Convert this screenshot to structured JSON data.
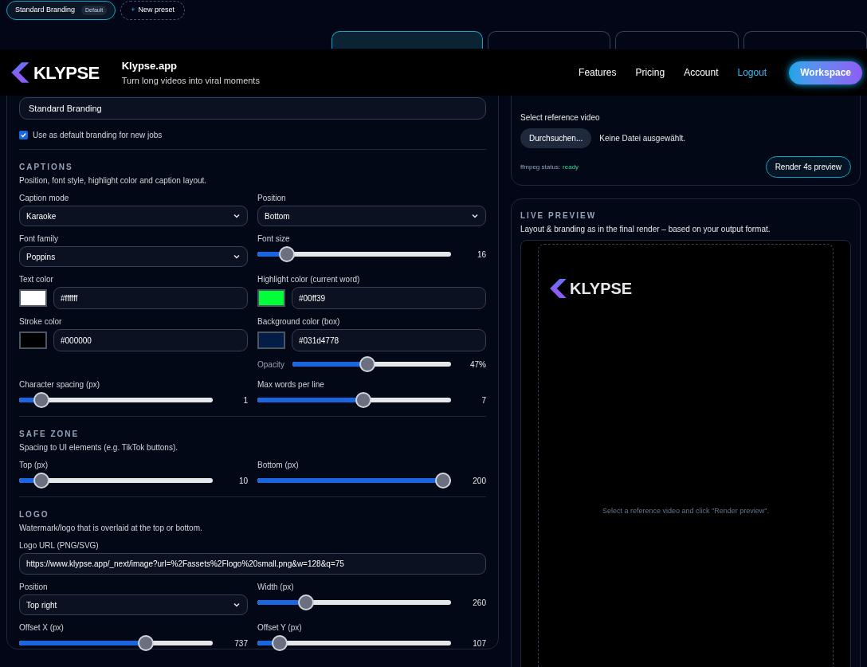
{
  "presets": [
    {
      "label": "Standard Branding",
      "badge": "Default",
      "selected": true
    }
  ],
  "new_preset": {
    "icon": "+",
    "label": "New preset"
  },
  "format_chips": [
    {
      "selected": true
    },
    {
      "selected": false
    },
    {
      "selected": false
    },
    {
      "selected": false
    }
  ],
  "header": {
    "logo_text": "KLYPSE",
    "title": "Klypse.app",
    "subtitle": "Turn long videos into viral moments",
    "nav": [
      {
        "label": "Features",
        "kind": "link"
      },
      {
        "label": "Pricing",
        "kind": "link"
      },
      {
        "label": "Account",
        "kind": "link"
      },
      {
        "label": "Logout",
        "kind": "accent"
      },
      {
        "label": "Workspace",
        "kind": "button"
      }
    ]
  },
  "preset_name": {
    "value": "Standard Branding"
  },
  "default_checkbox": {
    "label": "Use as default branding for new jobs",
    "checked": true
  },
  "sections": [
    {
      "heading": "CAPTIONS",
      "description": "Position, font style, highlight color and caption layout.",
      "fields": [
        {
          "kind": "select",
          "label": "Caption mode",
          "value": "Karaoke"
        },
        {
          "kind": "select",
          "label": "Position",
          "value": "Bottom"
        },
        {
          "kind": "select",
          "label": "Font family",
          "value": "Poppins"
        },
        {
          "kind": "slider",
          "label": "Font size",
          "level": 0.12,
          "reading": "16"
        },
        {
          "kind": "color",
          "label": "Text color",
          "value": "#ffffff",
          "color": "#ffffff"
        },
        {
          "kind": "color",
          "label": "Highlight color (current word)",
          "value": "#00ff39",
          "color": "#00ff39"
        },
        {
          "kind": "color",
          "label": "Stroke color",
          "value": "#000000",
          "color": "#000000"
        },
        {
          "kind": "color",
          "label": "Background color (box)",
          "value": "#031d4778",
          "color": "#031d47",
          "opacity": {
            "label": "Opacity",
            "level": 0.47,
            "reading": "47%"
          }
        },
        {
          "kind": "slider",
          "label": "Character spacing (px)",
          "level": 0.08,
          "reading": "1"
        },
        {
          "kind": "slider",
          "label": "Max words per line",
          "level": 0.55,
          "reading": "7"
        }
      ]
    },
    {
      "heading": "SAFE ZONE",
      "description": "Spacing to UI elements (e.g. TikTok buttons).",
      "fields": [
        {
          "kind": "slider",
          "label": "Top (px)",
          "level": 0.08,
          "reading": "10"
        },
        {
          "kind": "slider",
          "label": "Bottom (px)",
          "level": 1,
          "reading": "200"
        }
      ]
    },
    {
      "heading": "LOGO",
      "description": "Watermark/logo that is overlaid at the top or bottom.",
      "fields": [
        {
          "kind": "text",
          "label": "Logo URL (PNG/SVG)",
          "value": "https://www.klypse.app/_next/image?url=%2Fassets%2Flogo%20small.png&w=128&q=75"
        },
        {
          "kind": "select",
          "label": "Position",
          "value": "Top right"
        },
        {
          "kind": "slider",
          "label": "Width (px)",
          "level": 0.23,
          "reading": "260"
        },
        {
          "kind": "slider",
          "label": "Offset X (px)",
          "level": 0.67,
          "reading": "737"
        },
        {
          "kind": "slider",
          "label": "Offset Y (px)",
          "level": 0.08,
          "reading": "107"
        }
      ]
    }
  ],
  "reference": {
    "label": "Select reference video",
    "browse_button": "Durchsuchen...",
    "file_status": "Keine Datei ausgewählt.",
    "status_label": "ffmpeg status:",
    "status_value": "ready",
    "render_button": "Render 4s preview"
  },
  "live_preview": {
    "heading": "LIVE PREVIEW",
    "description": "Layout & branding as in the final render – based on your output format.",
    "logo_text": "KLYPSE",
    "hint": "Select a reference video and click \"Render preview\"."
  }
}
